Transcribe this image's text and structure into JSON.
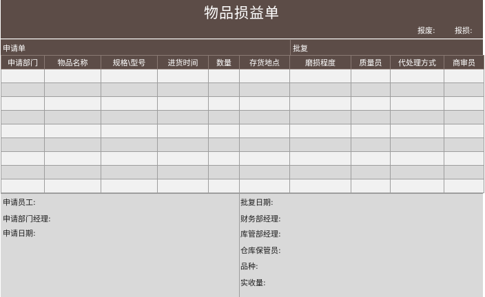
{
  "form": {
    "title": "物品损益单",
    "report_loss_label": "报废:",
    "report_damage_label": "报损:"
  },
  "sections": {
    "request": "申请单",
    "approval": "批复"
  },
  "table": {
    "headers": [
      "申请部门",
      "物品名称",
      "规格\\型号",
      "进货时间",
      "数量",
      "存货地点",
      "磨损程度",
      "质量员",
      "代处理方式",
      "商审员"
    ]
  },
  "footer": {
    "left": [
      "申请员工:",
      "申请部门经理:",
      "申请日期:"
    ],
    "right": [
      "批复日期:",
      "财务部经理:",
      "库管部经理:",
      "仓库保管员:",
      "品种:",
      "实收量:"
    ]
  }
}
